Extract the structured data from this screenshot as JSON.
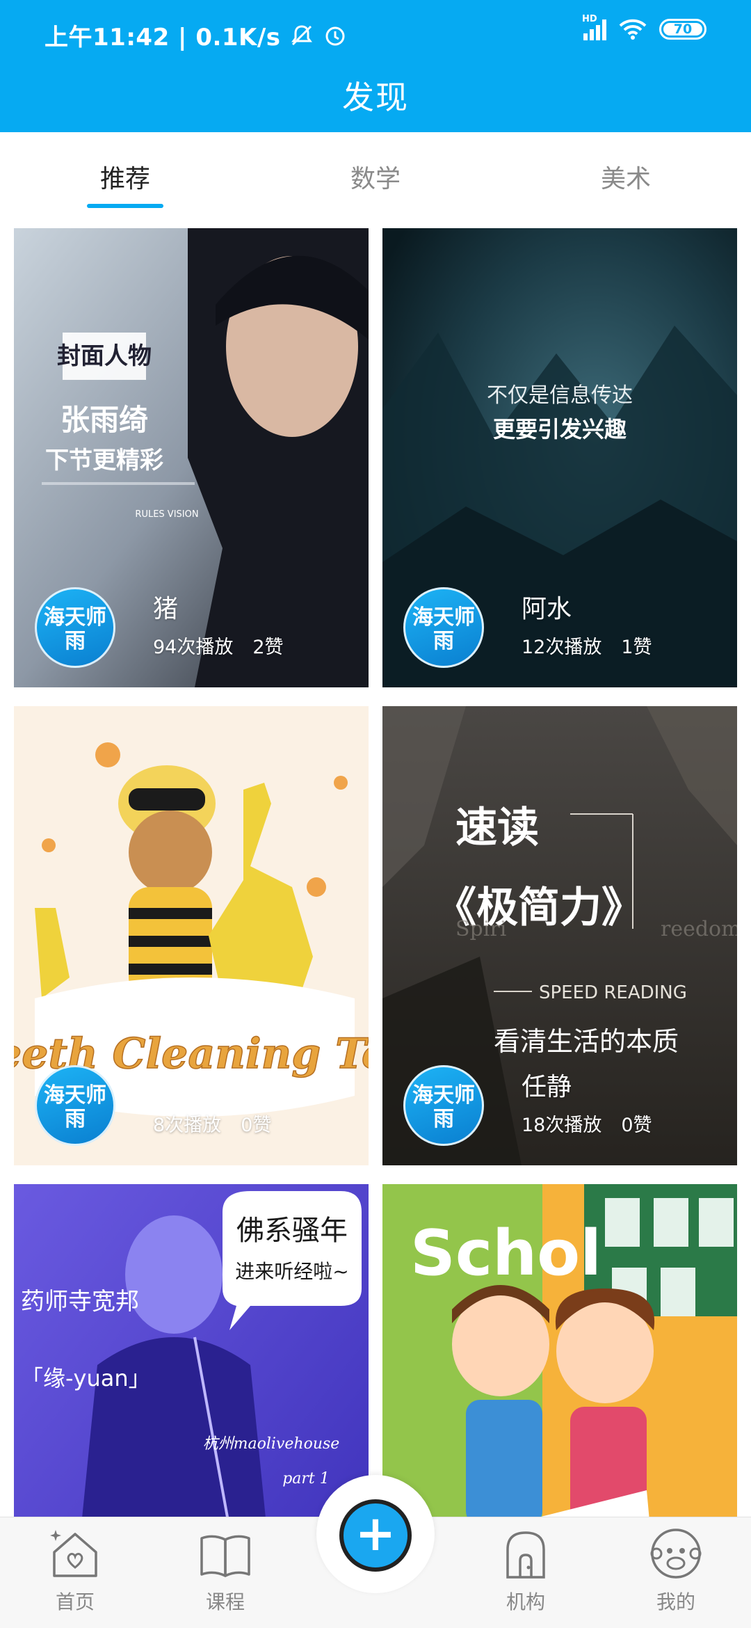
{
  "status_bar": {
    "time": "上午11:42 | 0.1K/s",
    "network": "HD",
    "battery": "70"
  },
  "header": {
    "title": "发现"
  },
  "tabs": [
    {
      "label": "推荐",
      "active": true
    },
    {
      "label": "数学",
      "active": false
    },
    {
      "label": "美术",
      "active": false
    }
  ],
  "cards": [
    {
      "title": "猪",
      "plays": "94次播放",
      "likes": "2赞",
      "avatar_text": "海天师雨",
      "cover_text": {
        "box": "封面人物",
        "name": "张雨绮",
        "tagline": "下节更精彩",
        "credits": "RULES VISION"
      }
    },
    {
      "title": "阿水",
      "plays": "12次播放",
      "likes": "1赞",
      "avatar_text": "海天师雨",
      "cover_text": {
        "line1": "不仅是信息传达",
        "line2": "更要引发兴趣"
      }
    },
    {
      "title": "",
      "plays": "8次播放",
      "likes": "0赞",
      "avatar_text": "海天师雨",
      "cover_text": {
        "banner": "Teeth Cleaning Toy"
      }
    },
    {
      "title": "任静",
      "plays": "18次播放",
      "likes": "0赞",
      "avatar_text": "海天师雨",
      "cover_text": {
        "line1": "速读",
        "line2": "《极简力》",
        "line3": "SPEED READING",
        "line4": "看清生活的本质",
        "bg_left": "Spiri",
        "bg_right": "reedom"
      }
    },
    {
      "title": "",
      "plays": "",
      "likes": "",
      "avatar_text": "",
      "cover_text": {
        "left1": "药师寺宽邦",
        "left2": "「缘-yuan」",
        "bubble1": "佛系骚年",
        "bubble2": "进来听经啦~",
        "venue": "杭州maolivehouse",
        "part": "part 1"
      }
    },
    {
      "title": "",
      "plays": "",
      "likes": "",
      "avatar_text": "",
      "cover_text": {
        "word": "Schol"
      }
    }
  ],
  "bottom_nav": [
    {
      "label": "首页",
      "icon": "home-icon"
    },
    {
      "label": "课程",
      "icon": "book-icon"
    },
    {
      "label": "机构",
      "icon": "building-icon"
    },
    {
      "label": "我的",
      "icon": "monkey-avatar-icon"
    }
  ],
  "fab": {
    "symbol": "+"
  },
  "colors": {
    "primary": "#06aaf2",
    "tab_indicator": "#06aaf2",
    "fab": "#1aa7f0"
  }
}
